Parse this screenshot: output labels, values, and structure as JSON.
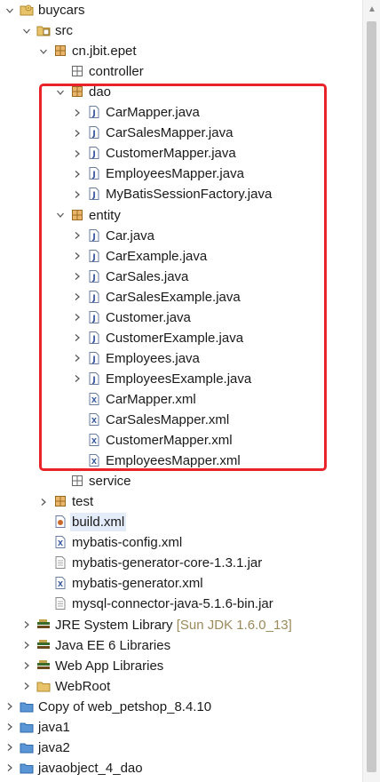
{
  "tree": {
    "rows": [
      {
        "label": "buycars",
        "depth": 0,
        "toggle": "open",
        "icon": "project-icon"
      },
      {
        "label": "src",
        "depth": 1,
        "toggle": "open",
        "icon": "source-folder-icon"
      },
      {
        "label": "cn.jbit.epet",
        "depth": 2,
        "toggle": "open",
        "icon": "package-icon"
      },
      {
        "label": "controller",
        "depth": 3,
        "toggle": "none",
        "icon": "package-empty-icon"
      },
      {
        "label": "dao",
        "depth": 3,
        "toggle": "open",
        "icon": "package-icon"
      },
      {
        "label": "CarMapper.java",
        "depth": 4,
        "toggle": "closed",
        "icon": "java-file-icon"
      },
      {
        "label": "CarSalesMapper.java",
        "depth": 4,
        "toggle": "closed",
        "icon": "java-file-icon"
      },
      {
        "label": "CustomerMapper.java",
        "depth": 4,
        "toggle": "closed",
        "icon": "java-file-icon"
      },
      {
        "label": "EmployeesMapper.java",
        "depth": 4,
        "toggle": "closed",
        "icon": "java-file-icon"
      },
      {
        "label": "MyBatisSessionFactory.java",
        "depth": 4,
        "toggle": "closed",
        "icon": "java-file-icon"
      },
      {
        "label": "entity",
        "depth": 3,
        "toggle": "open",
        "icon": "package-icon"
      },
      {
        "label": "Car.java",
        "depth": 4,
        "toggle": "closed",
        "icon": "java-file-icon"
      },
      {
        "label": "CarExample.java",
        "depth": 4,
        "toggle": "closed",
        "icon": "java-file-icon"
      },
      {
        "label": "CarSales.java",
        "depth": 4,
        "toggle": "closed",
        "icon": "java-file-icon"
      },
      {
        "label": "CarSalesExample.java",
        "depth": 4,
        "toggle": "closed",
        "icon": "java-file-icon"
      },
      {
        "label": "Customer.java",
        "depth": 4,
        "toggle": "closed",
        "icon": "java-file-icon"
      },
      {
        "label": "CustomerExample.java",
        "depth": 4,
        "toggle": "closed",
        "icon": "java-file-icon"
      },
      {
        "label": "Employees.java",
        "depth": 4,
        "toggle": "closed",
        "icon": "java-file-icon"
      },
      {
        "label": "EmployeesExample.java",
        "depth": 4,
        "toggle": "closed",
        "icon": "java-file-icon"
      },
      {
        "label": "CarMapper.xml",
        "depth": 4,
        "toggle": "none",
        "icon": "xml-file-icon"
      },
      {
        "label": "CarSalesMapper.xml",
        "depth": 4,
        "toggle": "none",
        "icon": "xml-file-icon"
      },
      {
        "label": "CustomerMapper.xml",
        "depth": 4,
        "toggle": "none",
        "icon": "xml-file-icon"
      },
      {
        "label": "EmployeesMapper.xml",
        "depth": 4,
        "toggle": "none",
        "icon": "xml-file-icon"
      },
      {
        "label": "service",
        "depth": 3,
        "toggle": "none",
        "icon": "package-empty-icon"
      },
      {
        "label": "test",
        "depth": 2,
        "toggle": "closed",
        "icon": "package-icon"
      },
      {
        "label": "build.xml",
        "depth": 2,
        "toggle": "none",
        "icon": "ant-file-icon",
        "selected": true
      },
      {
        "label": "mybatis-config.xml",
        "depth": 2,
        "toggle": "none",
        "icon": "xml-file-icon"
      },
      {
        "label": "mybatis-generator-core-1.3.1.jar",
        "depth": 2,
        "toggle": "none",
        "icon": "jar-file-icon"
      },
      {
        "label": "mybatis-generator.xml",
        "depth": 2,
        "toggle": "none",
        "icon": "xml-file-icon"
      },
      {
        "label": "mysql-connector-java-5.1.6-bin.jar",
        "depth": 2,
        "toggle": "none",
        "icon": "jar-file-icon"
      },
      {
        "label": "JRE System Library",
        "decoration": "[Sun JDK 1.6.0_13]",
        "depth": 1,
        "toggle": "closed",
        "icon": "library-icon"
      },
      {
        "label": "Java EE 6 Libraries",
        "depth": 1,
        "toggle": "closed",
        "icon": "library-icon"
      },
      {
        "label": "Web App Libraries",
        "depth": 1,
        "toggle": "closed",
        "icon": "library-icon"
      },
      {
        "label": "WebRoot",
        "depth": 1,
        "toggle": "closed",
        "icon": "folder-icon"
      },
      {
        "label": "Copy of web_petshop_8.4.10",
        "depth": 0,
        "toggle": "closed",
        "icon": "project-closed-icon"
      },
      {
        "label": "java1",
        "depth": 0,
        "toggle": "closed",
        "icon": "project-closed-icon"
      },
      {
        "label": "java2",
        "depth": 0,
        "toggle": "closed",
        "icon": "project-closed-icon"
      },
      {
        "label": "javaobject_4_dao",
        "depth": 0,
        "toggle": "closed",
        "icon": "project-closed-icon"
      }
    ]
  },
  "colors": {
    "highlight_border": "#e8232a",
    "selection": "#e3ecf8",
    "decoration_text": "#9a8a5a"
  }
}
